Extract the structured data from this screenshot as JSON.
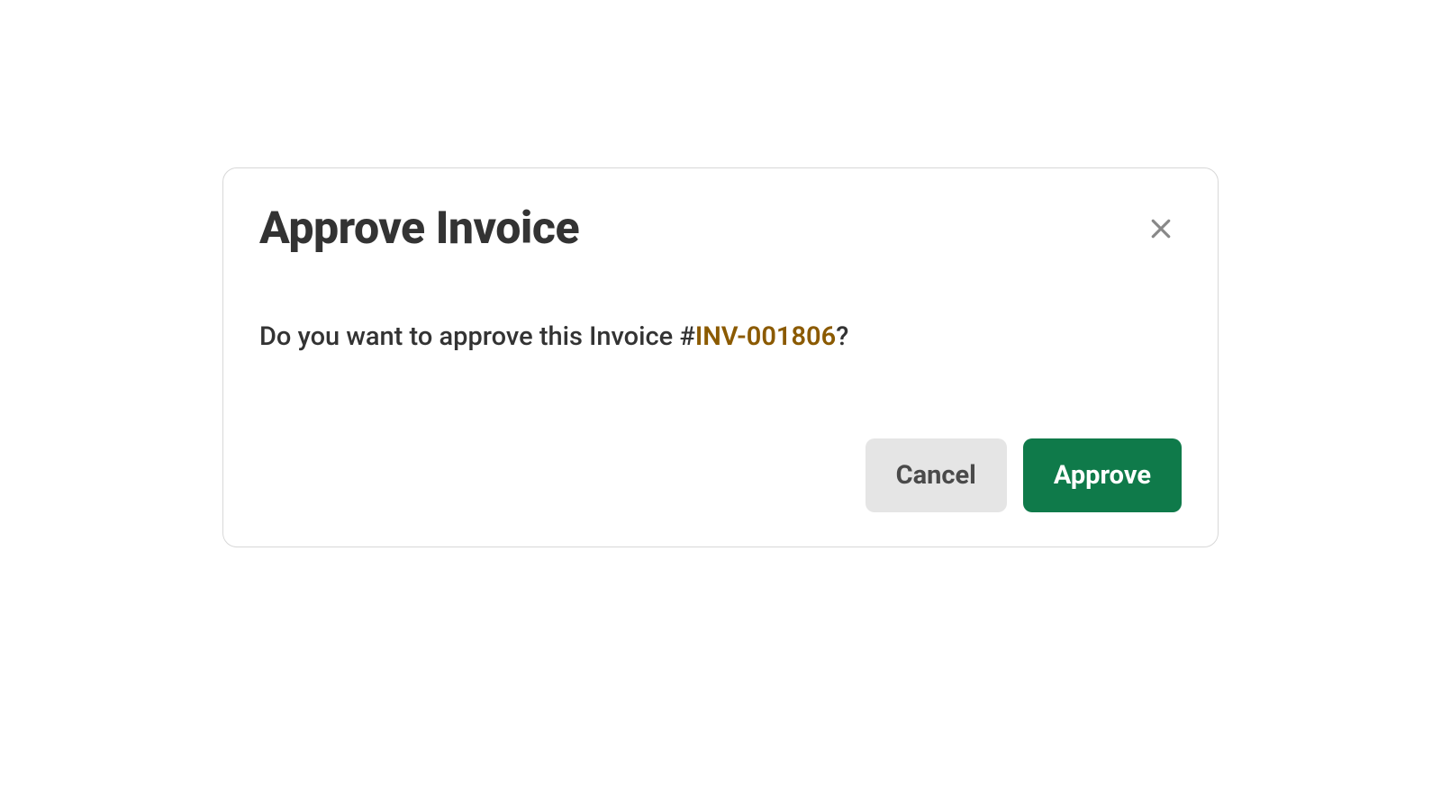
{
  "dialog": {
    "title": "Approve Invoice",
    "body_prefix": "Do you want to approve this Invoice #",
    "invoice_number": "INV-001806",
    "body_suffix": "?",
    "footer": {
      "cancel_label": "Cancel",
      "approve_label": "Approve"
    }
  }
}
